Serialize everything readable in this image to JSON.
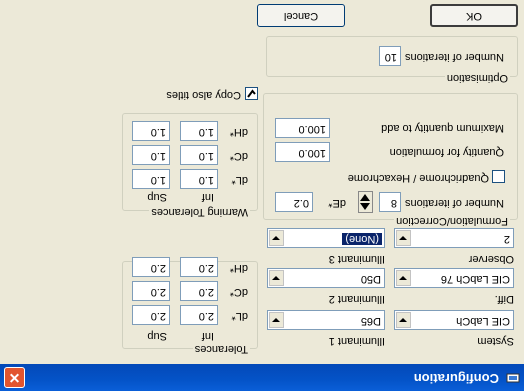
{
  "window": {
    "title": "Configuration",
    "close_glyph": "✕"
  },
  "buttons": {
    "ok": "OK",
    "cancel": "Cancel"
  },
  "formulation": {
    "group_label": "Formulation/Correction",
    "observer": {
      "label": "Observer",
      "value": "2"
    },
    "illuminant3": {
      "label": "Illuminant 3",
      "value": "(None)"
    },
    "diff": {
      "label": "Diff.",
      "value": "CIE LabCh 76"
    },
    "illuminant2": {
      "label": "Illuminant 2",
      "value": "D50"
    },
    "system": {
      "label": "System",
      "value": "CIE LabCh"
    },
    "illuminant1": {
      "label": "Illuminant 1",
      "value": "D65"
    }
  },
  "correction": {
    "max_quantity_label": "Maximum quantity to add",
    "max_quantity_value": "100.0",
    "quantity_formulation_label": "Quantity for formulation",
    "quantity_formulation_value": "100.0",
    "quadrichrome_label": "Quadrichrome / Hexachrome",
    "quadrichrome_checked": false,
    "iterations_label": "Number of iterations",
    "iterations_value": "8",
    "de_label": "dE*",
    "de_value": "0.2"
  },
  "optimisation": {
    "group_label": "Optimisation",
    "iterations_label": "Number of iterations",
    "iterations_value": "10"
  },
  "copy_also_titles": {
    "label": "Copy also titles",
    "checked": true
  },
  "warning_tolerances": {
    "group_label": "Warning Tolerances",
    "rows": [
      {
        "label": "dL*",
        "inf": "1.0",
        "sup": "1.0"
      },
      {
        "label": "dC*",
        "inf": "1.0",
        "sup": "1.0"
      },
      {
        "label": "dH*",
        "inf": "1.0",
        "sup": "1.0"
      }
    ],
    "inf_label": "Inf",
    "sup_label": "Sup"
  },
  "tolerances": {
    "group_label": "Tolerances",
    "rows": [
      {
        "label": "dL*",
        "inf": "2.0",
        "sup": "2.0"
      },
      {
        "label": "dC*",
        "inf": "2.0",
        "sup": "2.0"
      },
      {
        "label": "dH*",
        "inf": "2.0",
        "sup": "2.0"
      }
    ],
    "inf_label": "Inf",
    "sup_label": "Sup"
  },
  "colors": {
    "titlebar": "#0453C8",
    "face": "#ECE9D8",
    "selection": "#0A246A"
  }
}
